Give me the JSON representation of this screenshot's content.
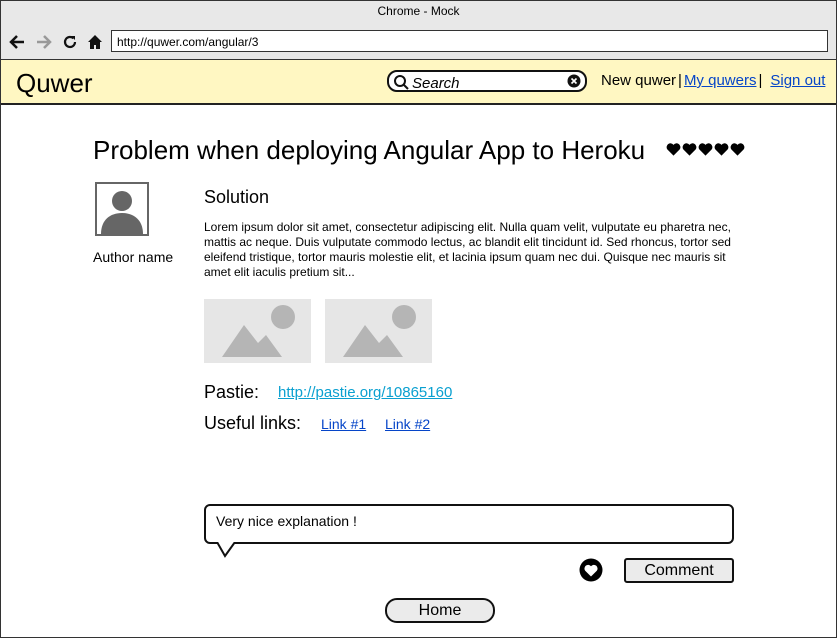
{
  "window": {
    "title": "Chrome - Mock"
  },
  "browser": {
    "url": "http://quwer.com/angular/3"
  },
  "app": {
    "brand": "Quwer",
    "search_placeholder": "Search",
    "nav": {
      "new": "New quwer",
      "sep": "|",
      "mine": "My quwers",
      "signout": "Sign out"
    }
  },
  "question": {
    "title": "Problem when deploying Angular App to Heroku",
    "rating_hearts": 5,
    "author": "Author name",
    "section_title": "Solution",
    "body": "Lorem ipsum dolor sit amet, consectetur adipiscing elit. Nulla quam velit, vulputate eu pharetra nec, mattis ac neque. Duis vulputate commodo lectus, ac blandit elit tincidunt id. Sed rhoncus, tortor sed eleifend tristique, tortor mauris molestie elit, et lacinia ipsum quam nec dui. Quisque nec mauris sit amet elit iaculis pretium sit...",
    "pastie_label": "Pastie:",
    "pastie_link": "http://pastie.org/10865160",
    "useful_label": "Useful links:",
    "links": [
      "Link #1",
      "Link #2"
    ]
  },
  "comment": {
    "value": "Very nice explanation !",
    "button": "Comment"
  },
  "footer": {
    "home": "Home"
  },
  "colors": {
    "appbar": "#fff7c2",
    "link": "#0645c8",
    "pastie": "#0aa0d0"
  }
}
